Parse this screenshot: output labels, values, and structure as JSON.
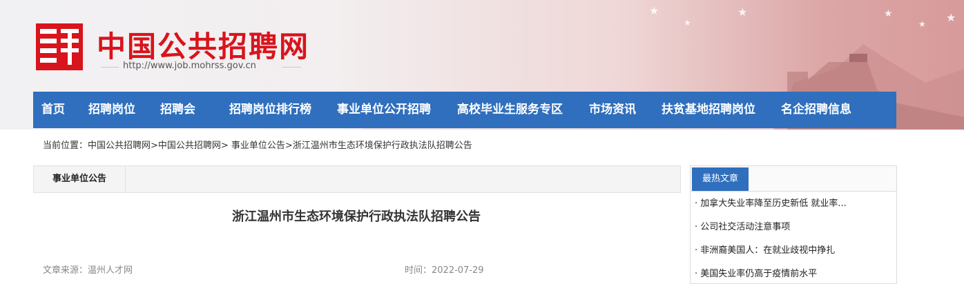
{
  "header": {
    "site_title": "中国公共招聘网",
    "site_url": "http://www.job.mohrss.gov.cn",
    "logo_icon": "pin-character-logo"
  },
  "nav": {
    "items": [
      {
        "label": "首页"
      },
      {
        "label": "招聘岗位"
      },
      {
        "label": "招聘会"
      },
      {
        "label": "招聘岗位排行榜"
      },
      {
        "label": "事业单位公开招聘"
      },
      {
        "label": "高校毕业生服务专区"
      },
      {
        "label": "市场资讯"
      },
      {
        "label": "扶贫基地招聘岗位"
      },
      {
        "label": "名企招聘信息"
      }
    ]
  },
  "breadcrumb": {
    "text": "当前位置：中国公共招聘网>中国公共招聘网> 事业单位公告>浙江温州市生态环境保护行政执法队招聘公告"
  },
  "main": {
    "section_tab": "事业单位公告",
    "article_title": "浙江温州市生态环境保护行政执法队招聘公告",
    "source": "文章来源：温州人才网",
    "time": "时间：2022-07-29"
  },
  "sidebar": {
    "tab_label": "最热文章",
    "items": [
      {
        "label": "· 加拿大失业率降至历史新低 就业率..."
      },
      {
        "label": "· 公司社交活动注意事项"
      },
      {
        "label": "· 非洲裔美国人：在就业歧视中挣扎"
      },
      {
        "label": "· 美国失业率仍高于疫情前水平"
      }
    ]
  },
  "colors": {
    "brand_red": "#d8141c",
    "nav_blue": "#2f6fbe"
  }
}
